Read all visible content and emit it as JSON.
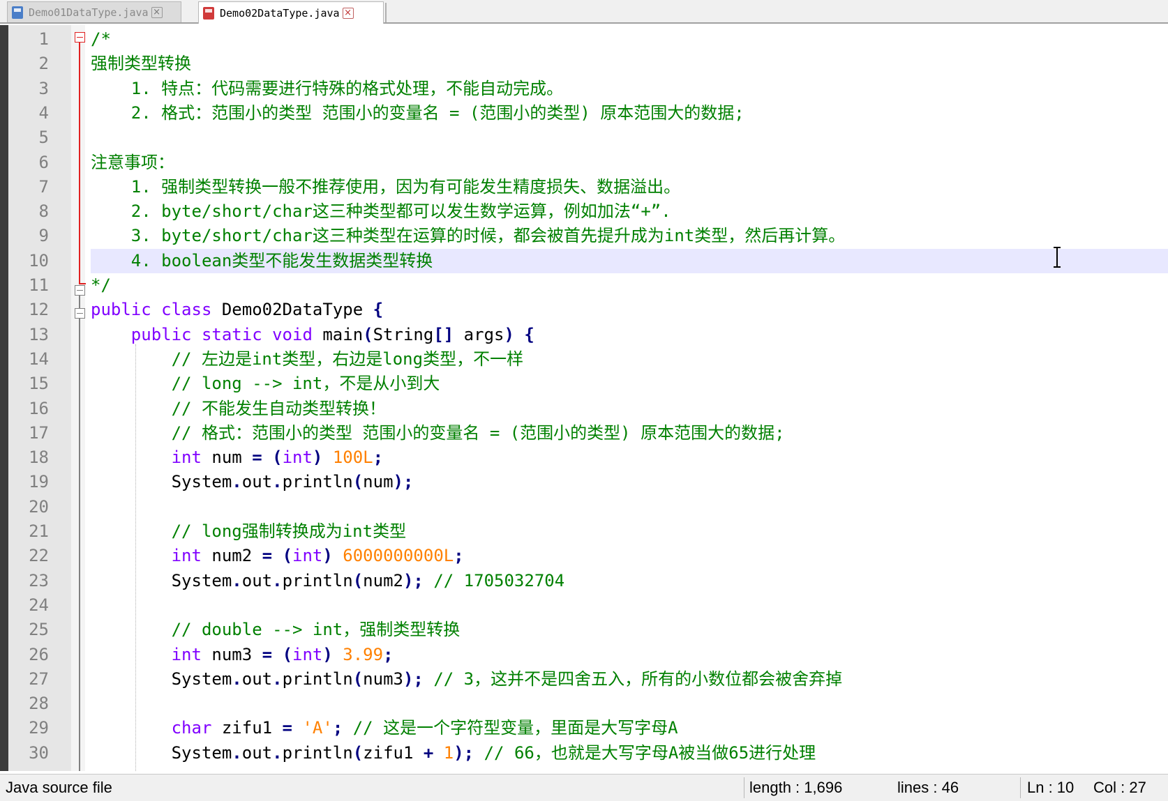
{
  "tabs": [
    {
      "label": "Demo01DataType.java",
      "active": false
    },
    {
      "label": "Demo02DataType.java",
      "active": true
    }
  ],
  "editor": {
    "current_line": 10,
    "lines": [
      {
        "n": "1",
        "tokens": [
          {
            "t": "/*",
            "c": "comment"
          }
        ]
      },
      {
        "n": "2",
        "tokens": [
          {
            "t": "强制类型转换",
            "c": "comment"
          }
        ]
      },
      {
        "n": "3",
        "tokens": [
          {
            "t": "    1. 特点：代码需要进行特殊的格式处理，不能自动完成。",
            "c": "comment"
          }
        ]
      },
      {
        "n": "4",
        "tokens": [
          {
            "t": "    2. 格式：范围小的类型 范围小的变量名 = (范围小的类型) 原本范围大的数据;",
            "c": "comment"
          }
        ]
      },
      {
        "n": "5",
        "tokens": []
      },
      {
        "n": "6",
        "tokens": [
          {
            "t": "注意事项：",
            "c": "comment"
          }
        ]
      },
      {
        "n": "7",
        "tokens": [
          {
            "t": "    1. 强制类型转换一般不推荐使用，因为有可能发生精度损失、数据溢出。",
            "c": "comment"
          }
        ]
      },
      {
        "n": "8",
        "tokens": [
          {
            "t": "    2. byte/short/char这三种类型都可以发生数学运算，例如加法“+”.",
            "c": "comment"
          }
        ]
      },
      {
        "n": "9",
        "tokens": [
          {
            "t": "    3. byte/short/char这三种类型在运算的时候，都会被首先提升成为int类型，然后再计算。",
            "c": "comment"
          }
        ]
      },
      {
        "n": "10",
        "tokens": [
          {
            "t": "    4. boolean类型不能发生数据类型转换",
            "c": "comment"
          }
        ]
      },
      {
        "n": "11",
        "tokens": [
          {
            "t": "*/",
            "c": "comment"
          }
        ]
      },
      {
        "n": "12",
        "tokens": [
          {
            "t": "public",
            "c": "kw"
          },
          {
            "t": " ",
            "c": ""
          },
          {
            "t": "class",
            "c": "kw"
          },
          {
            "t": " Demo02DataType ",
            "c": ""
          },
          {
            "t": "{",
            "c": "op"
          }
        ]
      },
      {
        "n": "13",
        "tokens": [
          {
            "t": "    ",
            "c": ""
          },
          {
            "t": "public",
            "c": "kw"
          },
          {
            "t": " ",
            "c": ""
          },
          {
            "t": "static",
            "c": "kw"
          },
          {
            "t": " ",
            "c": ""
          },
          {
            "t": "void",
            "c": "kw"
          },
          {
            "t": " main",
            "c": ""
          },
          {
            "t": "(",
            "c": "op"
          },
          {
            "t": "String",
            "c": ""
          },
          {
            "t": "[]",
            "c": "op"
          },
          {
            "t": " args",
            "c": ""
          },
          {
            "t": ")",
            "c": "op"
          },
          {
            "t": " ",
            "c": ""
          },
          {
            "t": "{",
            "c": "op"
          }
        ]
      },
      {
        "n": "14",
        "tokens": [
          {
            "t": "        ",
            "c": ""
          },
          {
            "t": "// 左边是int类型，右边是long类型，不一样",
            "c": "comment"
          }
        ]
      },
      {
        "n": "15",
        "tokens": [
          {
            "t": "        ",
            "c": ""
          },
          {
            "t": "// long --> int，不是从小到大",
            "c": "comment"
          }
        ]
      },
      {
        "n": "16",
        "tokens": [
          {
            "t": "        ",
            "c": ""
          },
          {
            "t": "// 不能发生自动类型转换！",
            "c": "comment"
          }
        ]
      },
      {
        "n": "17",
        "tokens": [
          {
            "t": "        ",
            "c": ""
          },
          {
            "t": "// 格式：范围小的类型 范围小的变量名 = (范围小的类型) 原本范围大的数据;",
            "c": "comment"
          }
        ]
      },
      {
        "n": "18",
        "tokens": [
          {
            "t": "        ",
            "c": ""
          },
          {
            "t": "int",
            "c": "kw"
          },
          {
            "t": " num ",
            "c": ""
          },
          {
            "t": "=",
            "c": "op"
          },
          {
            "t": " ",
            "c": ""
          },
          {
            "t": "(",
            "c": "op"
          },
          {
            "t": "int",
            "c": "kw"
          },
          {
            "t": ")",
            "c": "op"
          },
          {
            "t": " ",
            "c": ""
          },
          {
            "t": "100L",
            "c": "num"
          },
          {
            "t": ";",
            "c": "op"
          }
        ]
      },
      {
        "n": "19",
        "tokens": [
          {
            "t": "        System",
            "c": ""
          },
          {
            "t": ".",
            "c": "op"
          },
          {
            "t": "out",
            "c": ""
          },
          {
            "t": ".",
            "c": "op"
          },
          {
            "t": "println",
            "c": ""
          },
          {
            "t": "(",
            "c": "op"
          },
          {
            "t": "num",
            "c": ""
          },
          {
            "t": ");",
            "c": "op"
          }
        ]
      },
      {
        "n": "20",
        "tokens": []
      },
      {
        "n": "21",
        "tokens": [
          {
            "t": "        ",
            "c": ""
          },
          {
            "t": "// long强制转换成为int类型",
            "c": "comment"
          }
        ]
      },
      {
        "n": "22",
        "tokens": [
          {
            "t": "        ",
            "c": ""
          },
          {
            "t": "int",
            "c": "kw"
          },
          {
            "t": " num2 ",
            "c": ""
          },
          {
            "t": "=",
            "c": "op"
          },
          {
            "t": " ",
            "c": ""
          },
          {
            "t": "(",
            "c": "op"
          },
          {
            "t": "int",
            "c": "kw"
          },
          {
            "t": ")",
            "c": "op"
          },
          {
            "t": " ",
            "c": ""
          },
          {
            "t": "6000000000L",
            "c": "num"
          },
          {
            "t": ";",
            "c": "op"
          }
        ]
      },
      {
        "n": "23",
        "tokens": [
          {
            "t": "        System",
            "c": ""
          },
          {
            "t": ".",
            "c": "op"
          },
          {
            "t": "out",
            "c": ""
          },
          {
            "t": ".",
            "c": "op"
          },
          {
            "t": "println",
            "c": ""
          },
          {
            "t": "(",
            "c": "op"
          },
          {
            "t": "num2",
            "c": ""
          },
          {
            "t": ");",
            "c": "op"
          },
          {
            "t": " ",
            "c": ""
          },
          {
            "t": "// 1705032704",
            "c": "comment"
          }
        ]
      },
      {
        "n": "24",
        "tokens": []
      },
      {
        "n": "25",
        "tokens": [
          {
            "t": "        ",
            "c": ""
          },
          {
            "t": "// double --> int，强制类型转换",
            "c": "comment"
          }
        ]
      },
      {
        "n": "26",
        "tokens": [
          {
            "t": "        ",
            "c": ""
          },
          {
            "t": "int",
            "c": "kw"
          },
          {
            "t": " num3 ",
            "c": ""
          },
          {
            "t": "=",
            "c": "op"
          },
          {
            "t": " ",
            "c": ""
          },
          {
            "t": "(",
            "c": "op"
          },
          {
            "t": "int",
            "c": "kw"
          },
          {
            "t": ")",
            "c": "op"
          },
          {
            "t": " ",
            "c": ""
          },
          {
            "t": "3.99",
            "c": "num"
          },
          {
            "t": ";",
            "c": "op"
          }
        ]
      },
      {
        "n": "27",
        "tokens": [
          {
            "t": "        System",
            "c": ""
          },
          {
            "t": ".",
            "c": "op"
          },
          {
            "t": "out",
            "c": ""
          },
          {
            "t": ".",
            "c": "op"
          },
          {
            "t": "println",
            "c": ""
          },
          {
            "t": "(",
            "c": "op"
          },
          {
            "t": "num3",
            "c": ""
          },
          {
            "t": ");",
            "c": "op"
          },
          {
            "t": " ",
            "c": ""
          },
          {
            "t": "// 3，这并不是四舍五入，所有的小数位都会被舍弃掉",
            "c": "comment"
          }
        ]
      },
      {
        "n": "28",
        "tokens": []
      },
      {
        "n": "29",
        "tokens": [
          {
            "t": "        ",
            "c": ""
          },
          {
            "t": "char",
            "c": "kw"
          },
          {
            "t": " zifu1 ",
            "c": ""
          },
          {
            "t": "=",
            "c": "op"
          },
          {
            "t": " ",
            "c": ""
          },
          {
            "t": "'A'",
            "c": "num"
          },
          {
            "t": ";",
            "c": "op"
          },
          {
            "t": " ",
            "c": ""
          },
          {
            "t": "// 这是一个字符型变量，里面是大写字母A",
            "c": "comment"
          }
        ]
      },
      {
        "n": "30",
        "tokens": [
          {
            "t": "        System",
            "c": ""
          },
          {
            "t": ".",
            "c": "op"
          },
          {
            "t": "out",
            "c": ""
          },
          {
            "t": ".",
            "c": "op"
          },
          {
            "t": "println",
            "c": ""
          },
          {
            "t": "(",
            "c": "op"
          },
          {
            "t": "zifu1 ",
            "c": ""
          },
          {
            "t": "+",
            "c": "op"
          },
          {
            "t": " ",
            "c": ""
          },
          {
            "t": "1",
            "c": "num"
          },
          {
            "t": ");",
            "c": "op"
          },
          {
            "t": " ",
            "c": ""
          },
          {
            "t": "// 66，也就是大写字母A被当做65进行处理",
            "c": "comment"
          }
        ]
      }
    ]
  },
  "status": {
    "file_type": "Java source file",
    "length": "length : 1,696",
    "lines": "lines : 46",
    "ln": "Ln : 10",
    "col": "Col : 27"
  },
  "colors": {
    "comment": "#008000",
    "keyword": "#8000ff",
    "number": "#ff8000",
    "operator": "#000080",
    "current_line_bg": "#e8e8ff"
  },
  "icons": [
    "java-file-icon",
    "modified-java-file-icon",
    "close-tab-icon",
    "fold-toggle-icon",
    "text-cursor-icon"
  ]
}
